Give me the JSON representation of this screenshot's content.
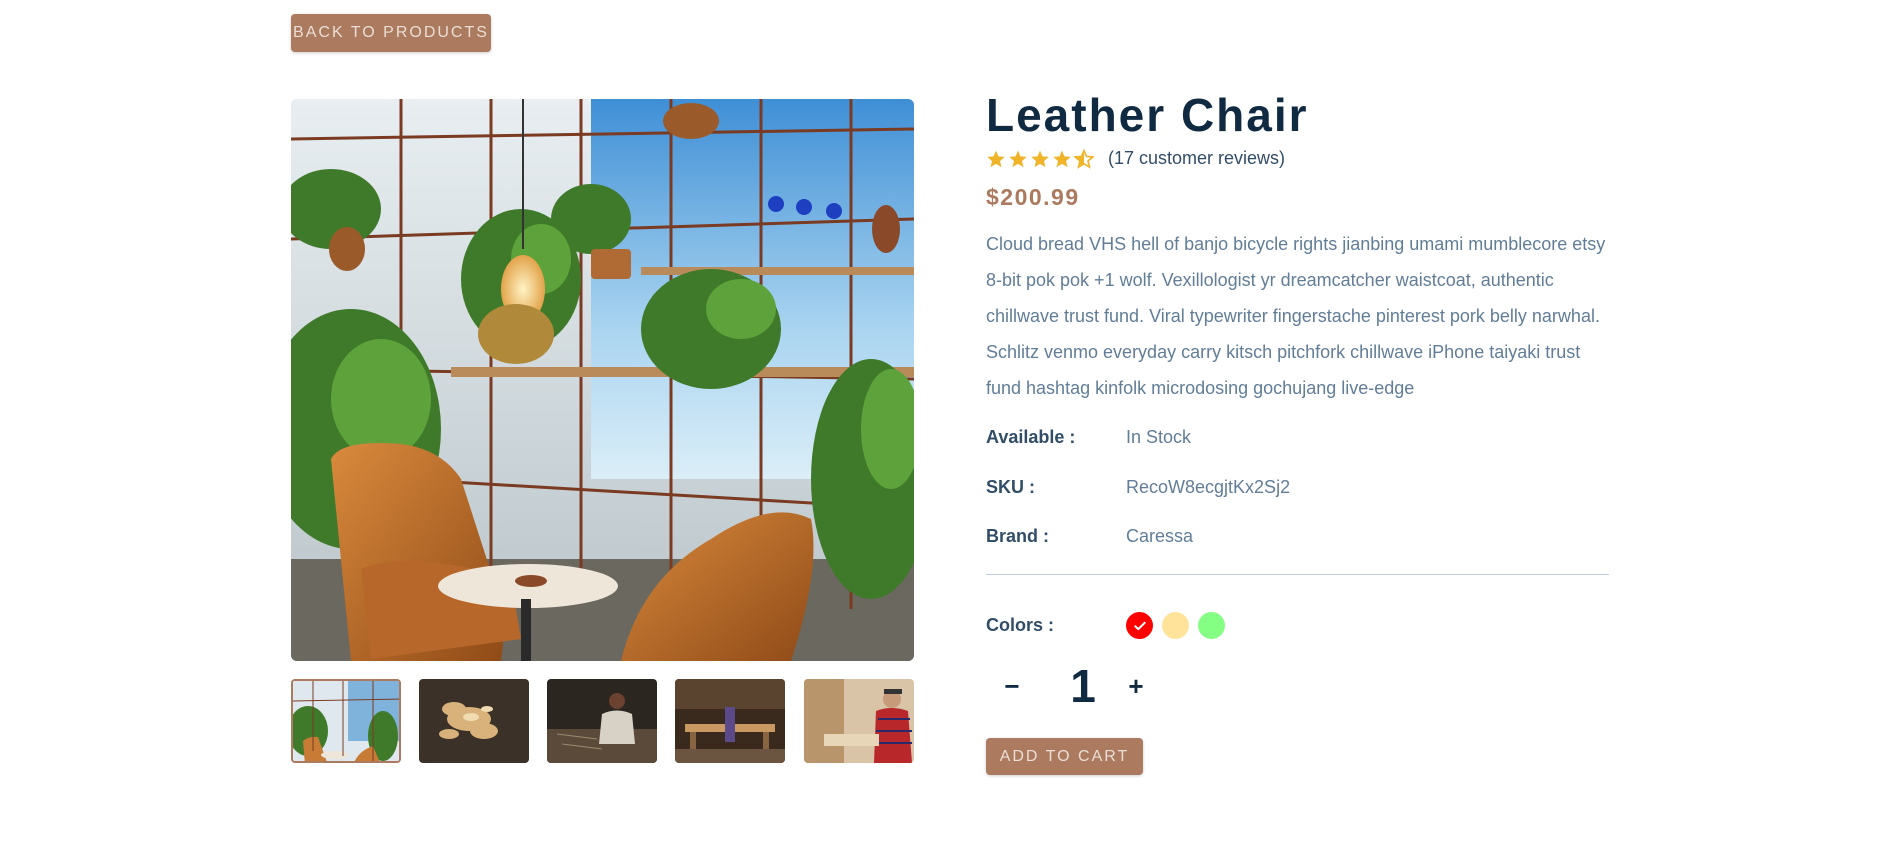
{
  "nav": {
    "back_label": "BACK TO PRODUCTS"
  },
  "gallery": {
    "main_image": "cafe-interior-leather-chairs-plants-photo",
    "thumbnails": [
      {
        "name": "cafe-interior-thumbnail",
        "active": true
      },
      {
        "name": "wood-shavings-thumbnail",
        "active": false
      },
      {
        "name": "craftsman-workshop-thumbnail",
        "active": false
      },
      {
        "name": "furniture-workshop-thumbnail",
        "active": false
      },
      {
        "name": "woodworker-thumbnail",
        "active": false
      }
    ]
  },
  "product": {
    "title": "Leather Chair",
    "rating": 4.5,
    "rating_max": 5,
    "reviews_text": "(17 customer reviews)",
    "price": "$200.99",
    "description": "Cloud bread VHS hell of banjo bicycle rights jianbing umami mumblecore etsy 8-bit pok pok +1 wolf. Vexillologist yr dreamcatcher waistcoat, authentic chillwave trust fund. Viral typewriter fingerstache pinterest pork belly narwhal. Schlitz venmo everyday carry kitsch pitchfork chillwave iPhone taiyaki trust fund hashtag kinfolk microdosing gochujang live-edge",
    "specs": {
      "available_label": "Available :",
      "available_value": "In Stock",
      "sku_label": "SKU :",
      "sku_value": "RecoW8ecgjtKx2Sj2",
      "brand_label": "Brand :",
      "brand_value": "Caressa"
    },
    "colors_label": "Colors :",
    "colors": [
      {
        "hex": "#ff0000",
        "selected": true
      },
      {
        "hex": "#ffe196",
        "selected": false
      },
      {
        "hex": "#7dff7d",
        "selected": false
      }
    ]
  },
  "cart": {
    "decrease_label": "−",
    "quantity": "1",
    "increase_label": "+",
    "add_label": "ADD TO CART"
  },
  "colors": {
    "accent": "#ab7a5f",
    "heading": "#102a42",
    "star": "#f0b429"
  }
}
